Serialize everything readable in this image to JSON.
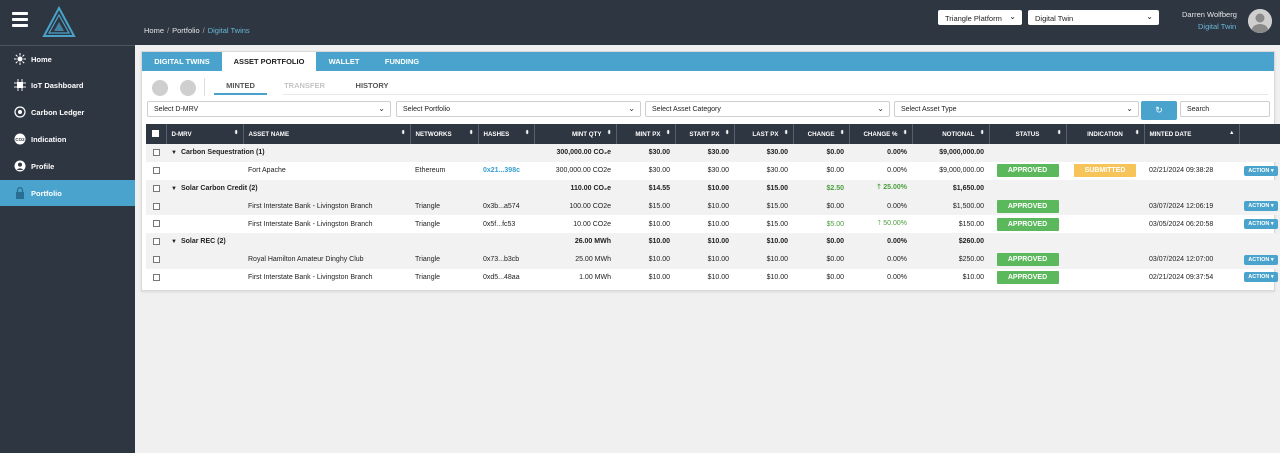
{
  "breadcrumb": [
    "Home",
    "Portfolio",
    "Digital Twins"
  ],
  "top": {
    "platform_select": "Triangle Platform",
    "view_select": "Digital Twin",
    "user_name": "Darren Wolfberg",
    "user_role": "Digital Twin"
  },
  "sidebar": {
    "items": [
      {
        "label": "Home",
        "icon": "home-icon"
      },
      {
        "label": "IoT Dashboard",
        "icon": "iot-icon"
      },
      {
        "label": "Carbon Ledger",
        "icon": "ledger-icon"
      },
      {
        "label": "Indication",
        "icon": "co2-icon"
      },
      {
        "label": "Profile",
        "icon": "user-icon"
      },
      {
        "label": "Portfolio",
        "icon": "lock-icon",
        "active": true
      }
    ]
  },
  "tabs": [
    "DIGITAL TWINS",
    "ASSET PORTFOLIO",
    "WALLET",
    "FUNDING"
  ],
  "active_tab": "ASSET PORTFOLIO",
  "subtabs": [
    {
      "label": "MINTED",
      "state": "active"
    },
    {
      "label": "TRANSFER",
      "state": "disabled"
    },
    {
      "label": "HISTORY",
      "state": "normal"
    }
  ],
  "filters": {
    "dmrv": "Select D-MRV",
    "portfolio": "Select Portfolio",
    "category": "Select Asset Category",
    "type": "Select Asset Type",
    "search_placeholder": "Search",
    "refresh_icon": "refresh-icon"
  },
  "columns": [
    "D-MRV",
    "ASSET NAME",
    "NETWORKS",
    "HASHES",
    "MINT QTY",
    "MINT PX",
    "START PX",
    "LAST PX",
    "CHANGE",
    "CHANGE %",
    "NOTIONAL",
    "STATUS",
    "INDICATION",
    "MINTED DATE"
  ],
  "rows": [
    {
      "kind": "group",
      "dmrv": "Carbon Sequestration (1)",
      "mint_qty": "300,000.00 CO₂e",
      "mint_px": "$30.00",
      "start_px": "$30.00",
      "last_px": "$30.00",
      "change": "$0.00",
      "change_pct": "0.00%",
      "notional": "$9,000,000.00"
    },
    {
      "kind": "asset",
      "asset": "Fort Apache",
      "network": "Ethereum",
      "hash": "0x21...398c",
      "hash_link": true,
      "mint_qty": "300,000.00 CO2e",
      "mint_px": "$30.00",
      "start_px": "$30.00",
      "last_px": "$30.00",
      "change": "$0.00",
      "change_pct": "0.00%",
      "notional": "$9,000,000.00",
      "status": "APPROVED",
      "indication": "SUBMITTED",
      "minted_date": "02/21/2024 09:38:28",
      "action": "ACTION"
    },
    {
      "kind": "group",
      "dmrv": "Solar Carbon Credit (2)",
      "mint_qty": "110.00 CO₂e",
      "mint_px": "$14.55",
      "start_px": "$10.00",
      "last_px": "$15.00",
      "change": "$2.50",
      "change_pct": "25.00%",
      "change_pos": true,
      "notional": "$1,650.00"
    },
    {
      "kind": "asset",
      "asset": "First Interstate Bank - Livingston Branch",
      "network": "Triangle",
      "hash": "0x3b...a574",
      "mint_qty": "100.00 CO2e",
      "mint_px": "$15.00",
      "start_px": "$10.00",
      "last_px": "$15.00",
      "change": "$0.00",
      "change_pct": "0.00%",
      "notional": "$1,500.00",
      "status": "APPROVED",
      "minted_date": "03/07/2024 12:06:19",
      "action": "ACTION"
    },
    {
      "kind": "asset",
      "asset": "First Interstate Bank - Livingston Branch",
      "network": "Triangle",
      "hash": "0x5f...fc53",
      "mint_qty": "10.00 CO2e",
      "mint_px": "$10.00",
      "start_px": "$10.00",
      "last_px": "$15.00",
      "change": "$5.00",
      "change_pct": "50.00%",
      "change_pos": true,
      "notional": "$150.00",
      "status": "APPROVED",
      "minted_date": "03/05/2024 06:20:58",
      "action": "ACTION"
    },
    {
      "kind": "group",
      "dmrv": "Solar REC (2)",
      "mint_qty": "26.00 MWh",
      "mint_px": "$10.00",
      "start_px": "$10.00",
      "last_px": "$10.00",
      "change": "$0.00",
      "change_pct": "0.00%",
      "notional": "$260.00"
    },
    {
      "kind": "asset",
      "asset": "Royal Hamilton Amateur Dinghy Club",
      "network": "Triangle",
      "hash": "0x73...b3cb",
      "mint_qty": "25.00 MWh",
      "mint_px": "$10.00",
      "start_px": "$10.00",
      "last_px": "$10.00",
      "change": "$0.00",
      "change_pct": "0.00%",
      "notional": "$250.00",
      "status": "APPROVED",
      "minted_date": "03/07/2024 12:07:00",
      "action": "ACTION"
    },
    {
      "kind": "asset",
      "asset": "First Interstate Bank - Livingston Branch",
      "network": "Triangle",
      "hash": "0xd5...48aa",
      "mint_qty": "1.00 MWh",
      "mint_px": "$10.00",
      "start_px": "$10.00",
      "last_px": "$10.00",
      "change": "$0.00",
      "change_pct": "0.00%",
      "notional": "$10.00",
      "status": "APPROVED",
      "minted_date": "02/21/2024 09:37:54",
      "action": "ACTION"
    }
  ],
  "colors": {
    "nav_bg": "#2e3641",
    "accent": "#4aa3cc",
    "approved": "#5cb85c",
    "submitted": "#f6c458",
    "positive": "#4a9e3c"
  }
}
